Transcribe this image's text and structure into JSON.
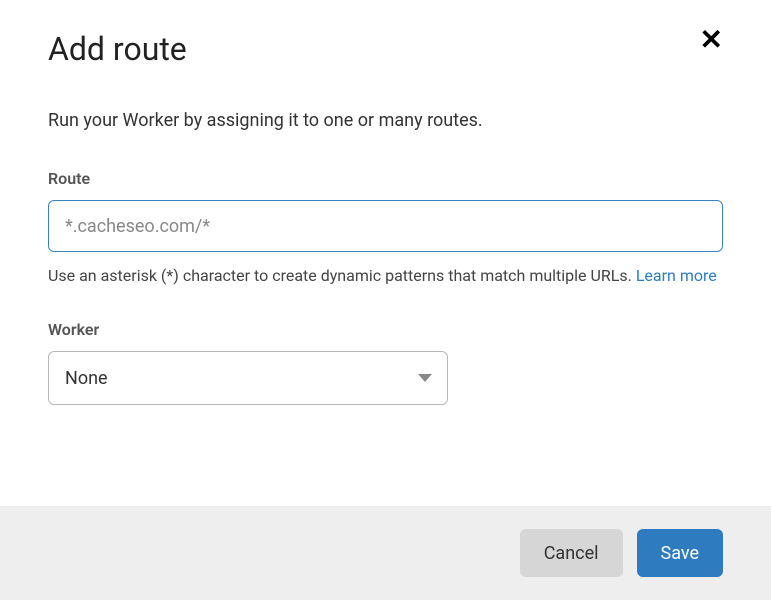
{
  "modal": {
    "title": "Add route",
    "description": "Run your Worker by assigning it to one or many routes."
  },
  "route": {
    "label": "Route",
    "placeholder": "*.cacheseo.com/*",
    "value": "",
    "help_text": "Use an asterisk (*) character to create dynamic patterns that match multiple URLs. ",
    "learn_more": "Learn more"
  },
  "worker": {
    "label": "Worker",
    "selected": "None"
  },
  "footer": {
    "cancel": "Cancel",
    "save": "Save"
  }
}
